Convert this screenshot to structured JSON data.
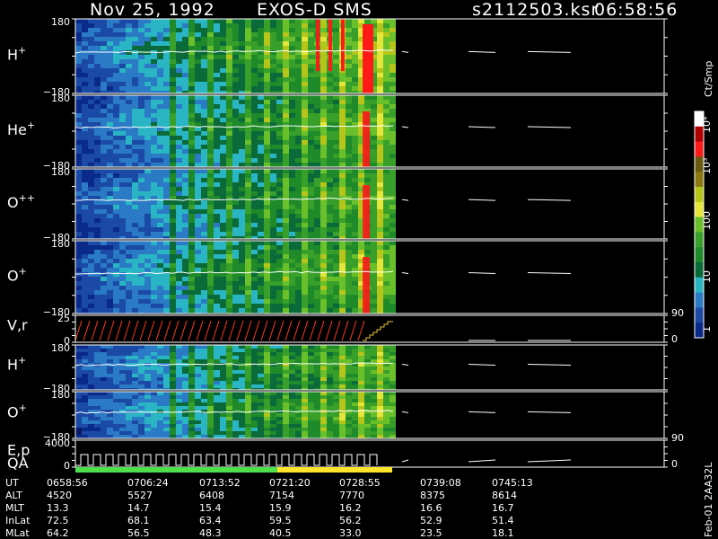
{
  "header": {
    "date": "Nov 25, 1992",
    "instrument": "EXOS-D SMS",
    "file": "s2112503.ksr",
    "time": "06:58:56"
  },
  "colors": {
    "background": "#000000",
    "foreground": "#ffffff",
    "trace": "#ffffff",
    "vr_trace": "#ff3a1a",
    "qa_good": "#4de04d",
    "qa_caution": "#ffe52a"
  },
  "colorbar": {
    "unit": "Ct/Smp",
    "labels": [
      "10⁴",
      "10³",
      "100",
      "10",
      "1"
    ],
    "scale": "log",
    "range": [
      1,
      10000
    ],
    "colors": [
      "#ffffff",
      "#b00000",
      "#ff1a1a",
      "#6a5a10",
      "#8a7a10",
      "#b5c51a",
      "#e5e53a",
      "#6ac02a",
      "#38a02a",
      "#1e8a2a",
      "#0a6a3a",
      "#2ab5c5",
      "#2a7ac5",
      "#1a4aa5",
      "#0a2a8a"
    ]
  },
  "panels": [
    {
      "id": "h-plus",
      "label": "H",
      "sup": "+",
      "ymax": "180",
      "ymin": "−180"
    },
    {
      "id": "he-plus",
      "label": "He",
      "sup": "+",
      "ymax": "180",
      "ymin": "−180"
    },
    {
      "id": "o-plusplus",
      "label": "O",
      "sup": "++",
      "ymax": "180",
      "ymin": "−180"
    },
    {
      "id": "o-plus",
      "label": "O",
      "sup": "+",
      "ymax": "180",
      "ymin": "−180"
    },
    {
      "id": "vr",
      "label": "V,r",
      "sup": "",
      "ymax": "25",
      "ymin": "0",
      "rmax": "90",
      "rmin": "0"
    },
    {
      "id": "h-plus-2",
      "label": "H",
      "sup": "+",
      "ymax": "180",
      "ymin": "−180"
    },
    {
      "id": "o-plus-2",
      "label": "O",
      "sup": "+",
      "ymax": "180",
      "ymin": "−180"
    },
    {
      "id": "ep",
      "label": "E,p",
      "label2": "QA",
      "sup": "",
      "ymax": "4000",
      "ymin": "0",
      "rmax": "90",
      "rmin": "0"
    }
  ],
  "footer": {
    "row_labels": [
      "UT",
      "ALT",
      "MLT",
      "InLat",
      "MLat"
    ],
    "columns": [
      {
        "UT": "0658:56",
        "ALT": "4520",
        "MLT": "13.3",
        "InLat": "72.5",
        "MLat": "64.2"
      },
      {
        "UT": "0706:24",
        "ALT": "5527",
        "MLT": "14.7",
        "InLat": "68.1",
        "MLat": "56.5"
      },
      {
        "UT": "0713:52",
        "ALT": "6408",
        "MLT": "15.4",
        "InLat": "63.4",
        "MLat": "48.3"
      },
      {
        "UT": "0721:20",
        "ALT": "7154",
        "MLT": "15.9",
        "InLat": "59.5",
        "MLat": "40.5"
      },
      {
        "UT": "0728:55",
        "ALT": "7770",
        "MLT": "16.2",
        "InLat": "56.2",
        "MLat": "33.0"
      },
      {
        "UT": "0739:08",
        "ALT": "8375",
        "MLT": "16.6",
        "InLat": "52.9",
        "MLat": "23.5"
      },
      {
        "UT": "0745:13",
        "ALT": "8614",
        "MLT": "16.7",
        "InLat": "51.4",
        "MLat": "18.1"
      }
    ],
    "side_label": "Feb-01 2AA32L"
  },
  "chart_data": {
    "type": "heatmap",
    "title": "Nov 25, 1992   EXOS-D SMS",
    "x_axis": "UT",
    "x_ticks": [
      "0658:56",
      "0706:24",
      "0713:52",
      "0721:20",
      "0728:55",
      "0739:08",
      "0745:13"
    ],
    "colorbar_unit": "Ct/Smp",
    "colorbar_range": [
      1,
      10000
    ],
    "colorbar_scale": "log",
    "series": [
      {
        "name": "H+",
        "ylim": [
          -180,
          180
        ]
      },
      {
        "name": "He+",
        "ylim": [
          -180,
          180
        ]
      },
      {
        "name": "O++",
        "ylim": [
          -180,
          180
        ]
      },
      {
        "name": "O+",
        "ylim": [
          -180,
          180
        ]
      },
      {
        "name": "V,r",
        "ylim": [
          0,
          25
        ],
        "right_ylim": [
          0,
          90
        ]
      },
      {
        "name": "H+",
        "ylim": [
          -180,
          180
        ]
      },
      {
        "name": "O+",
        "ylim": [
          -180,
          180
        ]
      },
      {
        "name": "E,p",
        "ylim": [
          0,
          4000
        ],
        "right_ylim": [
          0,
          90
        ]
      }
    ]
  }
}
